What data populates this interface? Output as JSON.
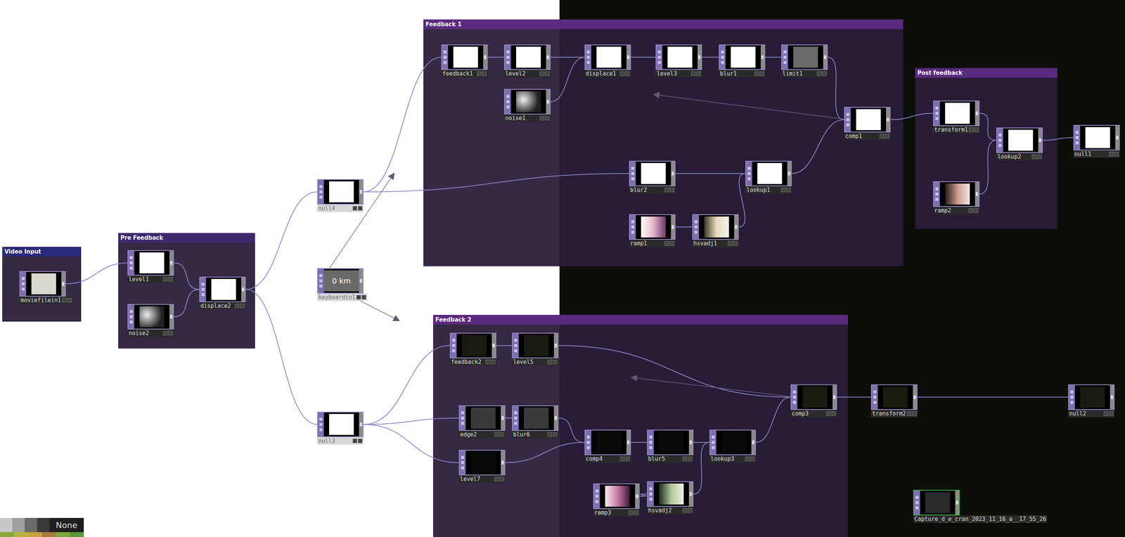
{
  "groups": [
    {
      "title": "Video Input",
      "color": "#2a2a7a"
    },
    {
      "title": "Pre Feedback",
      "color": "#3d2a6e"
    },
    {
      "title": "Feedback 1",
      "color": "#5a2a7e"
    },
    {
      "title": "Post feedback",
      "color": "#5a2a7e"
    },
    {
      "title": "Feedback 2",
      "color": "#5a2a7e"
    }
  ],
  "nodes": [
    {
      "label": "moviefilein1",
      "kind": "image",
      "thumb": "#d8d8d0",
      "dim": false
    },
    {
      "label": "level1",
      "kind": "image",
      "thumb": "#ffffff",
      "dim": false
    },
    {
      "label": "noise2",
      "kind": "noise",
      "thumb": "#888888",
      "dim": false
    },
    {
      "label": "displace2",
      "kind": "image",
      "thumb": "#ffffff",
      "dim": false
    },
    {
      "label": "null4",
      "kind": "image",
      "thumb": "#ffffff",
      "dim": true
    },
    {
      "label": "keyboardin1",
      "kind": "chop",
      "value": "0 km",
      "thumb": "#6a6a6a",
      "dim": true
    },
    {
      "label": "null3",
      "kind": "image",
      "thumb": "#ffffff",
      "dim": true
    },
    {
      "label": "feedback1",
      "kind": "image",
      "thumb": "#ffffff",
      "dim": false
    },
    {
      "label": "level2",
      "kind": "image",
      "thumb": "#ffffff",
      "dim": false
    },
    {
      "label": "displace1",
      "kind": "image",
      "thumb": "#ffffff",
      "dim": false
    },
    {
      "label": "level3",
      "kind": "image",
      "thumb": "#ffffff",
      "dim": false
    },
    {
      "label": "blur1",
      "kind": "image",
      "thumb": "#ffffff",
      "dim": false
    },
    {
      "label": "limit1",
      "kind": "image",
      "thumb": "#6a6a6a",
      "dim": false
    },
    {
      "label": "noise1",
      "kind": "noise",
      "thumb": "#888888",
      "dim": false
    },
    {
      "label": "comp1",
      "kind": "image",
      "thumb": "#ffffff",
      "dim": false
    },
    {
      "label": "blur2",
      "kind": "image",
      "thumb": "#ffffff",
      "dim": false
    },
    {
      "label": "lookup1",
      "kind": "image",
      "thumb": "#ffffff",
      "dim": false
    },
    {
      "label": "ramp1",
      "kind": "ramp",
      "gradient": [
        "#ffffff",
        "#e6b4c8",
        "#6a3a6a"
      ],
      "dim": false
    },
    {
      "label": "hsvadj1",
      "kind": "ramp",
      "gradient": [
        "#3a3a2a",
        "#e8dcc0",
        "#f4f0e8"
      ],
      "dim": false
    },
    {
      "label": "transform1",
      "kind": "image",
      "thumb": "#ffffff",
      "dim": false
    },
    {
      "label": "lookup2",
      "kind": "image",
      "thumb": "#ffffff",
      "dim": false
    },
    {
      "label": "ramp2",
      "kind": "ramp",
      "gradient": [
        "#2a1a1a",
        "#c89a8a",
        "#f0e8e8"
      ],
      "dim": false
    },
    {
      "label": "null1",
      "kind": "image",
      "thumb": "#ffffff",
      "dim": false
    },
    {
      "label": "feedback2",
      "kind": "image",
      "thumb": "#1a1a10",
      "dim": false
    },
    {
      "label": "level5",
      "kind": "image",
      "thumb": "#1a1a10",
      "dim": false
    },
    {
      "label": "edge2",
      "kind": "image",
      "thumb": "#3a3a3a",
      "dim": false
    },
    {
      "label": "blur6",
      "kind": "image",
      "thumb": "#3a3a3a",
      "dim": false
    },
    {
      "label": "level7",
      "kind": "image",
      "thumb": "#0a0a0a",
      "dim": false
    },
    {
      "label": "comp4",
      "kind": "image",
      "thumb": "#0a0a0a",
      "dim": false
    },
    {
      "label": "blur5",
      "kind": "image",
      "thumb": "#0a0a0a",
      "dim": false
    },
    {
      "label": "lookup3",
      "kind": "image",
      "thumb": "#0a0a0a",
      "dim": false
    },
    {
      "label": "ramp3",
      "kind": "ramp",
      "gradient": [
        "#f4e8ec",
        "#c87aa8",
        "#3a1a3a"
      ],
      "dim": false
    },
    {
      "label": "hsvadj2",
      "kind": "ramp",
      "gradient": [
        "#1a2a1a",
        "#b4c8a0",
        "#f0f0e0"
      ],
      "dim": false
    },
    {
      "label": "comp3",
      "kind": "image",
      "thumb": "#1a1a10",
      "dim": false
    },
    {
      "label": "transform2",
      "kind": "image",
      "thumb": "#1a1a10",
      "dim": false
    },
    {
      "label": "null2",
      "kind": "image",
      "thumb": "#1a1a10",
      "dim": false
    },
    {
      "label": "Capture_d_e_cran_2023_11_16_a__17_55_26",
      "kind": "file",
      "thumb": "#2a2a2a",
      "dim": false
    }
  ],
  "wires": [
    [
      0,
      1
    ],
    [
      1,
      3
    ],
    [
      2,
      3
    ],
    [
      3,
      4
    ],
    [
      3,
      6
    ],
    [
      4,
      7
    ],
    [
      7,
      8
    ],
    [
      8,
      9
    ],
    [
      13,
      9
    ],
    [
      9,
      10
    ],
    [
      10,
      11
    ],
    [
      11,
      12
    ],
    [
      12,
      14
    ],
    [
      4,
      15
    ],
    [
      15,
      16
    ],
    [
      17,
      18
    ],
    [
      18,
      16
    ],
    [
      16,
      14
    ],
    [
      14,
      19
    ],
    [
      19,
      20
    ],
    [
      21,
      20
    ],
    [
      20,
      22
    ],
    [
      6,
      23
    ],
    [
      23,
      24
    ],
    [
      24,
      33
    ],
    [
      6,
      25
    ],
    [
      25,
      26
    ],
    [
      6,
      27
    ],
    [
      26,
      28
    ],
    [
      27,
      28
    ],
    [
      28,
      29
    ],
    [
      29,
      30
    ],
    [
      31,
      32
    ],
    [
      32,
      30
    ],
    [
      30,
      33
    ],
    [
      33,
      34
    ],
    [
      34,
      35
    ]
  ],
  "targets": [
    [
      14,
      7
    ],
    [
      33,
      23
    ],
    [
      5,
      7
    ],
    [
      5,
      23
    ]
  ],
  "palette": {
    "swatches": [
      "#c8c8c8",
      "#a0a0a0",
      "#6a6a6a",
      "#3a3a3a"
    ],
    "label": "None",
    "strip": [
      "#8aa83a",
      "#b4b43a",
      "#c8a03a",
      "#a87a3a",
      "#7aa83a",
      "#5a9a3a"
    ]
  }
}
